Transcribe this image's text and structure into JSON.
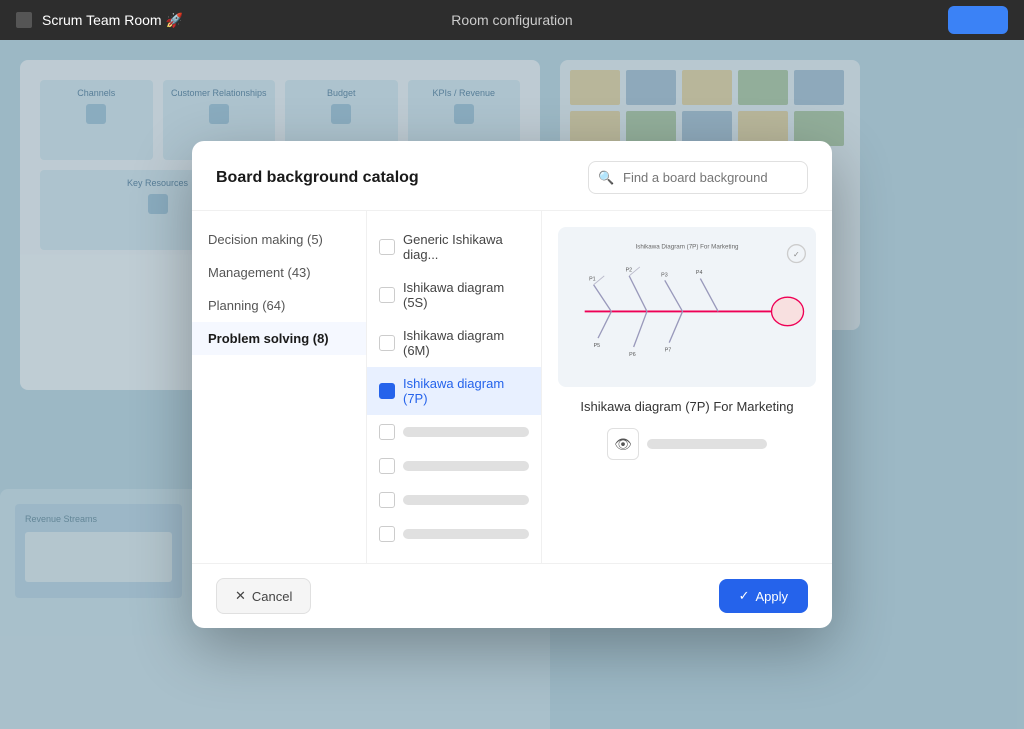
{
  "titlebar": {
    "icon": "board-icon",
    "title": "Scrum Team Room 🚀",
    "center": "Room configuration",
    "button_label": ""
  },
  "dialog": {
    "title": "Board background catalog",
    "search_placeholder": "Find a board background",
    "categories": [
      {
        "id": "decision-making",
        "label": "Decision making (5)",
        "count": 5
      },
      {
        "id": "management",
        "label": "Management (43)",
        "count": 43
      },
      {
        "id": "planning",
        "label": "Planning (64)",
        "count": 64
      },
      {
        "id": "problem-solving",
        "label": "Problem solving (8)",
        "count": 8,
        "active": true
      }
    ],
    "templates": [
      {
        "id": "generic-ishikawa",
        "label": "Generic Ishikawa diag...",
        "selected": false
      },
      {
        "id": "ishikawa-5s",
        "label": "Ishikawa diagram (5S)",
        "selected": false
      },
      {
        "id": "ishikawa-6m",
        "label": "Ishikawa diagram (6M)",
        "selected": false
      },
      {
        "id": "ishikawa-7p",
        "label": "Ishikawa diagram (7P)",
        "selected": true
      },
      {
        "id": "placeholder-1",
        "label": "",
        "selected": false
      },
      {
        "id": "placeholder-2",
        "label": "",
        "selected": false
      },
      {
        "id": "placeholder-3",
        "label": "",
        "selected": false
      },
      {
        "id": "placeholder-4",
        "label": "",
        "selected": false
      }
    ],
    "preview": {
      "title": "Ishikawa diagram (7P) For Marketing"
    },
    "footer": {
      "cancel_label": "Cancel",
      "apply_label": "Apply"
    }
  }
}
